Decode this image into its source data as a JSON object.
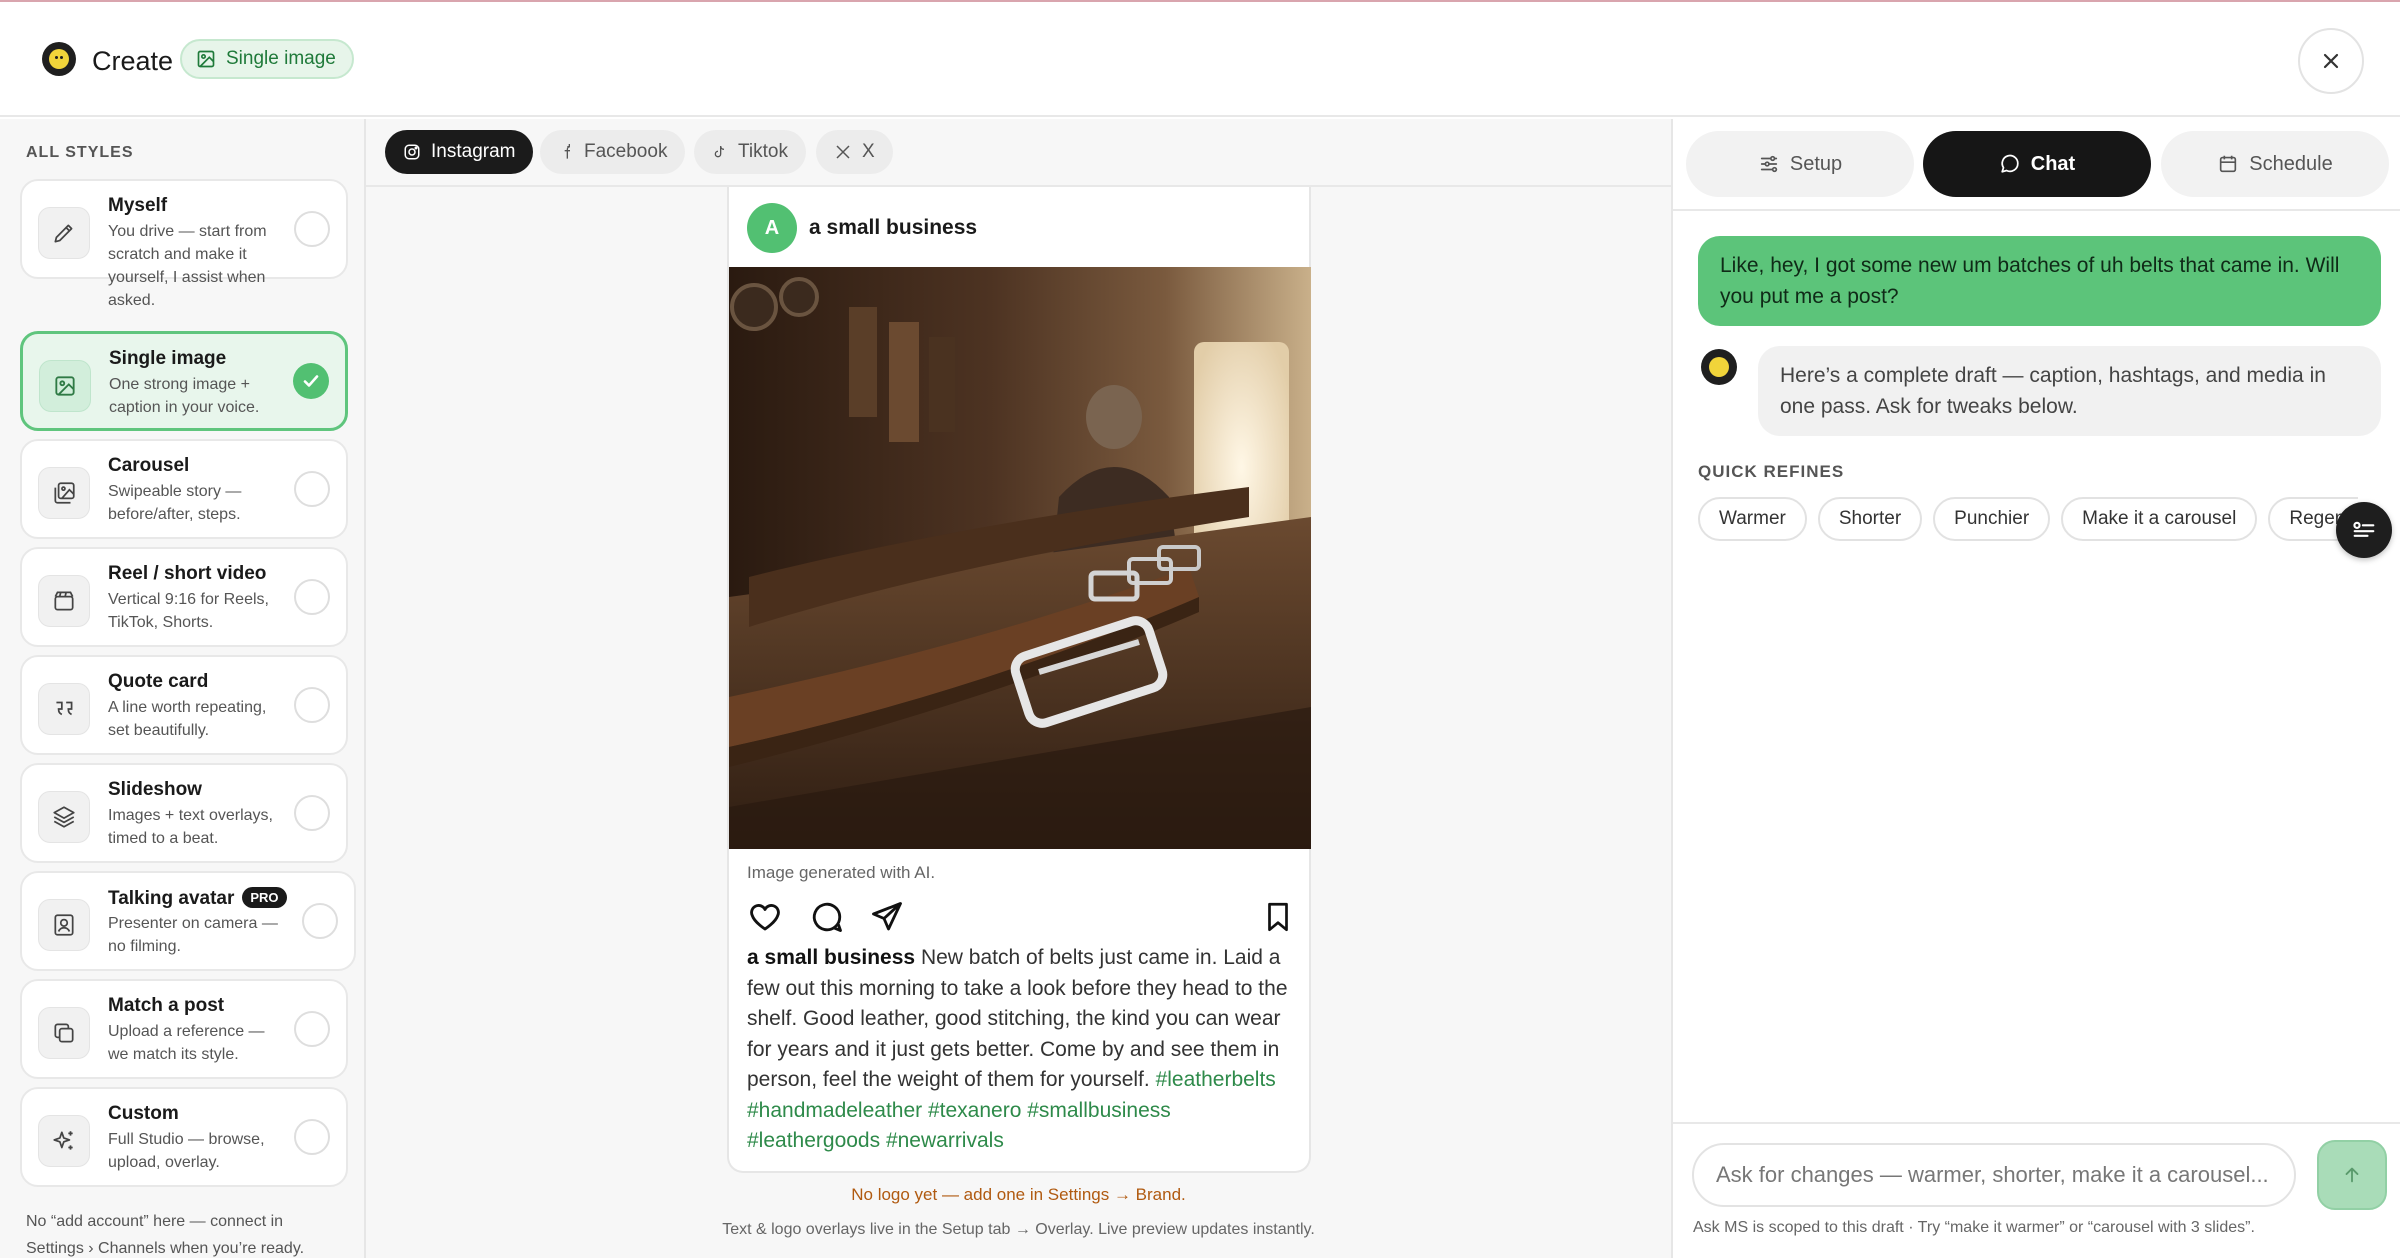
{
  "header": {
    "title": "Create",
    "chip_label": "Single image"
  },
  "sidebar": {
    "section_title": "ALL STYLES",
    "items": [
      {
        "title": "Myself",
        "desc": "You drive — start from scratch and make it yourself, I assist when asked."
      },
      {
        "title": "Single image",
        "desc": "One strong image + caption in your voice."
      },
      {
        "title": "Carousel",
        "desc": "Swipeable story — before/after, steps."
      },
      {
        "title": "Reel / short video",
        "desc": "Vertical 9:16 for Reels, TikTok, Shorts."
      },
      {
        "title": "Quote card",
        "desc": "A line worth repeating, set beautifully."
      },
      {
        "title": "Slideshow",
        "desc": "Images + text overlays, timed to a beat."
      },
      {
        "title": "Talking avatar",
        "badge": "PRO",
        "desc": "Presenter on camera — no filming."
      },
      {
        "title": "Match a post",
        "desc": "Upload a reference — we match its style."
      },
      {
        "title": "Custom",
        "desc": "Full Studio — browse, upload, overlay."
      }
    ],
    "selected_index": 1,
    "footer": "No “add account” here — connect in Settings › Channels when you’re ready."
  },
  "platform_tabs": [
    {
      "label": "Instagram",
      "icon": "instagram-icon"
    },
    {
      "label": "Facebook",
      "icon": "facebook-icon"
    },
    {
      "label": "Tiktok",
      "icon": "tiktok-icon"
    },
    {
      "label": "X",
      "icon": "x-icon"
    }
  ],
  "active_platform": "Instagram",
  "post": {
    "avatar_letter": "A",
    "account_name": "a small business",
    "ai_note": "Image generated with AI.",
    "caption_name": "a small business",
    "caption_text": "New batch of belts just came in. Laid a few out this morning to take a look before they head to the shelf. Good leather, good stitching, the kind you can wear for years and it just gets better. Come by and see them in person, feel the weight of them for yourself.",
    "hashtags": "#leatherbelts #handmadeleather #texanero #smallbusiness #leathergoods #newarrivals"
  },
  "preview_notes": {
    "warning": "No logo yet — add one in Settings → Brand.",
    "hint": "Text & logo overlays live in the Setup tab → Overlay. Live preview updates instantly."
  },
  "right_tabs": [
    {
      "label": "Setup",
      "icon": "sliders-icon"
    },
    {
      "label": "Chat",
      "icon": "chat-icon"
    },
    {
      "label": "Schedule",
      "icon": "calendar-icon"
    }
  ],
  "active_right_tab": "Chat",
  "chat": {
    "messages": [
      {
        "role": "user",
        "text": "Like, hey, I got some new um batches of uh belts that came in. Will you put me a post?"
      },
      {
        "role": "assistant",
        "text": "Here’s a complete draft — caption, hashtags, and media in one pass. Ask for tweaks below."
      }
    ],
    "quick_refines_title": "QUICK REFINES",
    "quick_refines": [
      "Warmer",
      "Shorter",
      "Punchier",
      "Make it a carousel",
      "Regenerate"
    ],
    "input_placeholder": "Ask for changes — warmer, shorter, make it a carousel...",
    "footer": "Ask MS is scoped to this draft · Try “make it warmer” or “carousel with 3 slides”."
  },
  "colors": {
    "accent_green": "#52c072",
    "user_bubble": "#5cc47a",
    "hashtag": "#2e8a4a",
    "warning": "#b05a10",
    "dark": "#1b1b1b"
  }
}
